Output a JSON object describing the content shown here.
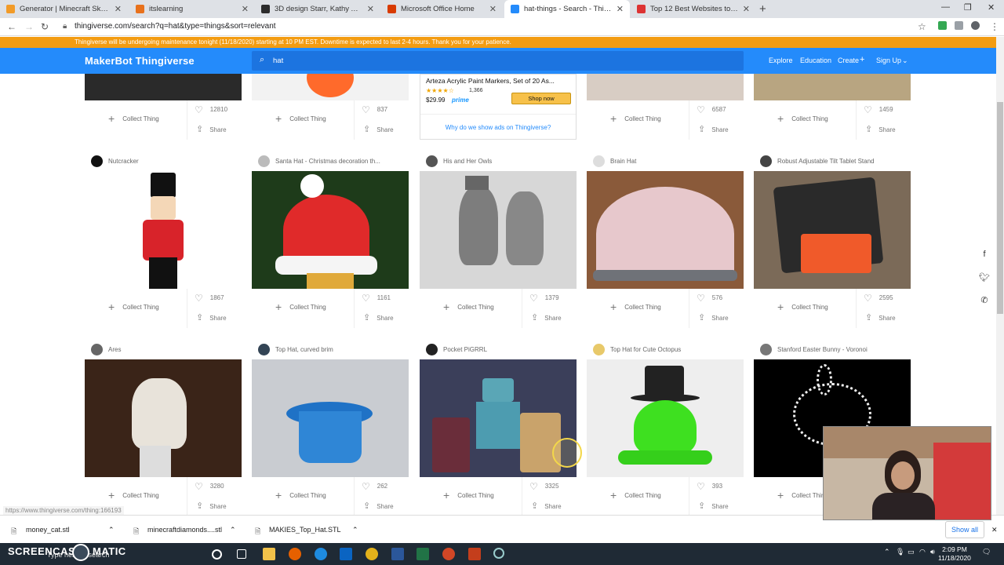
{
  "browser": {
    "tabs": [
      {
        "label": "Generator | Minecraft Skins",
        "color": "#f29b28"
      },
      {
        "label": "itslearning",
        "color": "#e8711c"
      },
      {
        "label": "3D design Starr, Kathy Avatar | T",
        "color": "#2c2c2c"
      },
      {
        "label": "Microsoft Office Home",
        "color": "#d83b01"
      },
      {
        "label": "hat-things - Search - Thingiverse",
        "color": "#248bfb"
      },
      {
        "label": "Top 12 Best Websites to Downlo",
        "color": "#d33"
      }
    ],
    "url": "thingiverse.com/search?q=hat&type=things&sort=relevant"
  },
  "banner": "Thingiverse will be undergoing maintenance tonight (11/18/2020) starting at 10 PM EST. Downtime is expected to last 2-4 hours. Thank you for your patience.",
  "navbar": {
    "logo": "MakerBot Thingiverse",
    "search_value": "hat",
    "explore": "Explore",
    "education": "Education",
    "create": "Create",
    "signup": "Sign Up"
  },
  "ad": {
    "title": "Arteza Acrylic Paint Markers, Set of 20 As...",
    "rating_count": "1,366",
    "price": "$29.99",
    "prime": "prime",
    "button": "Shop now",
    "why": "Why do we show ads on Thingiverse?"
  },
  "labels": {
    "collect": "Collect Thing",
    "share": "Share"
  },
  "top_row": [
    {
      "likes": "12810"
    },
    {
      "likes": "837"
    },
    {
      "likes": "6587"
    },
    {
      "likes": "1459"
    }
  ],
  "row2": [
    {
      "title": "Nutcracker",
      "likes": "1867"
    },
    {
      "title": "Santa Hat - Christmas decoration th...",
      "likes": "1161"
    },
    {
      "title": "His and Her Owls",
      "likes": "1379"
    },
    {
      "title": "Brain Hat",
      "likes": "576"
    },
    {
      "title": "Robust Adjustable Tilt Tablet Stand",
      "likes": "2595"
    }
  ],
  "row3": [
    {
      "title": "Ares",
      "likes": "3280"
    },
    {
      "title": "Top Hat, curved brim",
      "likes": "262"
    },
    {
      "title": "Pocket PiGRRL",
      "likes": "3325"
    },
    {
      "title": "Top Hat for Cute Octopus",
      "likes": "393"
    },
    {
      "title": "Stanford Easter Bunny - Voronoi",
      "likes": ""
    }
  ],
  "downloads": [
    {
      "name": "money_cat.stl"
    },
    {
      "name": "minecraftdiamonds....stl"
    },
    {
      "name": "MAKIES_Top_Hat.STL"
    }
  ],
  "show_all": "Show all",
  "status_url": "https://www.thingiverse.com/thing:166193",
  "taskbar": {
    "search_placeholder": "Type here to search",
    "time": "2:09 PM",
    "date": "11/18/2020"
  },
  "watermark": {
    "line1": "RECORDED WITH",
    "line2": "SCREENCAST",
    "line3": "MATIC"
  }
}
